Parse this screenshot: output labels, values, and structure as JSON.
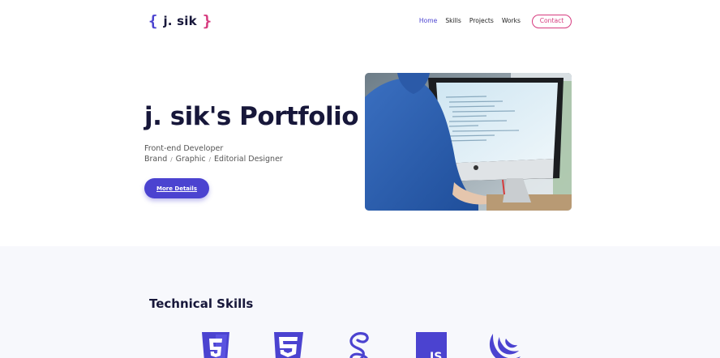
{
  "header": {
    "logo": {
      "brace_open": "{",
      "text": "j. sik",
      "brace_close": "}"
    },
    "nav": [
      {
        "label": "Home",
        "active": true
      },
      {
        "label": "Skills",
        "active": false
      },
      {
        "label": "Projects",
        "active": false
      },
      {
        "label": "Works",
        "active": false
      }
    ],
    "contact_label": "Contact"
  },
  "hero": {
    "title": "j. sik's Portfolio",
    "subtitle": "Front-end Developer",
    "roles": [
      "Brand",
      "Graphic",
      "Editorial Designer"
    ],
    "separator": "/",
    "button_label": "More Details"
  },
  "skills": {
    "title": "Technical Skills",
    "icons": [
      "html5-icon",
      "css3-icon",
      "sass-icon",
      "javascript-icon",
      "jquery-icon"
    ],
    "js_text": "JS"
  },
  "colors": {
    "primary": "#4b43d0",
    "accent": "#d63a7e",
    "dark": "#17173a",
    "section_bg": "#f7f8fc"
  }
}
